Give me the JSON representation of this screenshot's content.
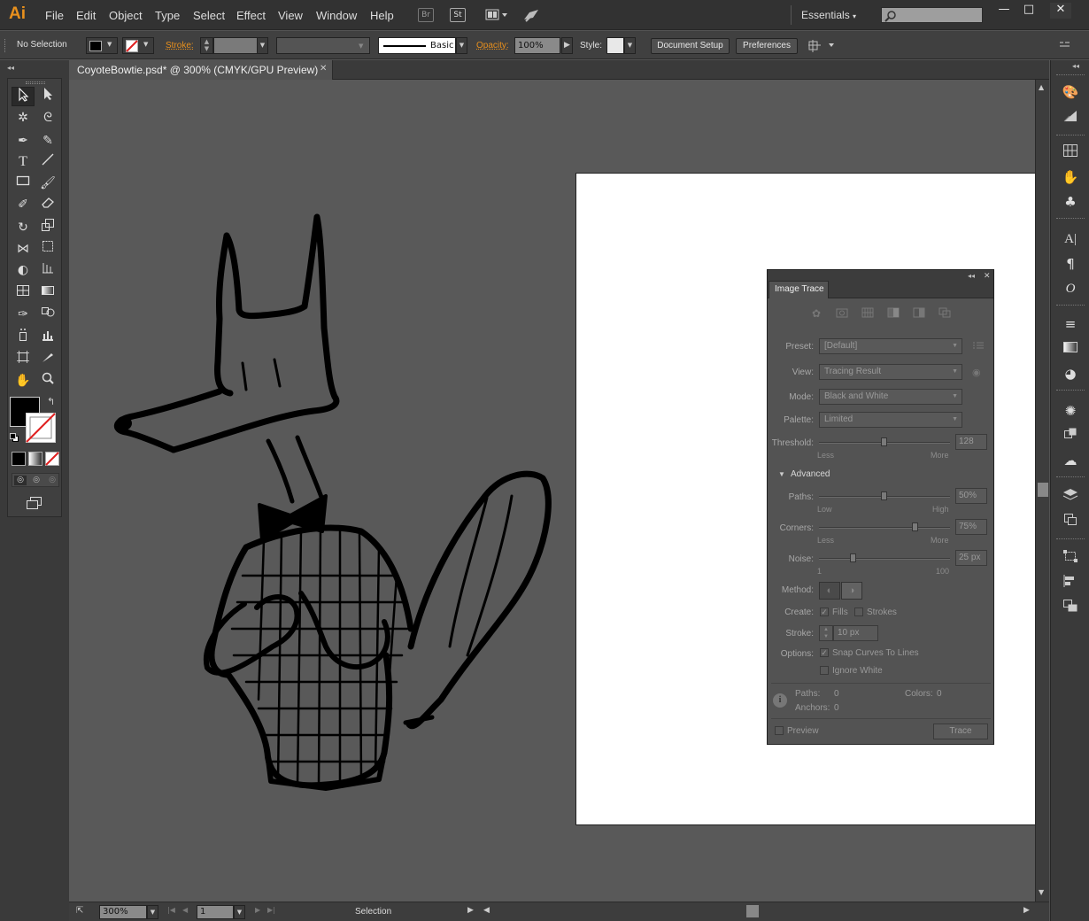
{
  "app": {
    "logo": "Ai"
  },
  "menubar": {
    "items": [
      "File",
      "Edit",
      "Object",
      "Type",
      "Select",
      "Effect",
      "View",
      "Window",
      "Help"
    ],
    "bridge": "Br",
    "stock": "St",
    "workspace": "Essentials",
    "window_controls": {
      "minimize": "—",
      "restore": "□",
      "close": "✕"
    }
  },
  "control_bar": {
    "selection": "No Selection",
    "stroke_label": "Stroke:",
    "brush": "Basic",
    "opacity_label": "Opacity:",
    "opacity_value": "100%",
    "style_label": "Style:",
    "document_setup": "Document Setup",
    "preferences": "Preferences"
  },
  "document": {
    "tab_title": "CoyoteBowtie.psd* @ 300% (CMYK/GPU Preview)"
  },
  "status_bar": {
    "zoom": "300%",
    "artboard": "1",
    "tool": "Selection"
  },
  "image_trace": {
    "title": "Image Trace",
    "preset_label": "Preset:",
    "preset_value": "[Default]",
    "view_label": "View:",
    "view_value": "Tracing Result",
    "mode_label": "Mode:",
    "mode_value": "Black and White",
    "palette_label": "Palette:",
    "palette_value": "Limited",
    "threshold_label": "Threshold:",
    "threshold_value": "128",
    "threshold_min": "Less",
    "threshold_max": "More",
    "advanced_label": "Advanced",
    "paths_label": "Paths:",
    "paths_value": "50%",
    "paths_min": "Low",
    "paths_max": "High",
    "corners_label": "Corners:",
    "corners_value": "75%",
    "corners_min": "Less",
    "corners_max": "More",
    "noise_label": "Noise:",
    "noise_value": "25 px",
    "noise_min": "1",
    "noise_max": "100",
    "method_label": "Method:",
    "create_label": "Create:",
    "fills_label": "Fills",
    "strokes_label": "Strokes",
    "stroke_label": "Stroke:",
    "stroke_value": "10 px",
    "options_label": "Options:",
    "snap_label": "Snap Curves To Lines",
    "ignore_white_label": "Ignore White",
    "paths_count_label": "Paths:",
    "paths_count": "0",
    "colors_label": "Colors:",
    "colors_count": "0",
    "anchors_label": "Anchors:",
    "anchors_count": "0",
    "preview_label": "Preview",
    "trace_button": "Trace",
    "sliders": {
      "threshold": 0.5,
      "paths": 0.5,
      "corners": 0.75,
      "noise": 0.25
    }
  },
  "colors": {
    "accent": "#e8901d",
    "canvas": "#595959",
    "artboard": "#ffffff"
  }
}
